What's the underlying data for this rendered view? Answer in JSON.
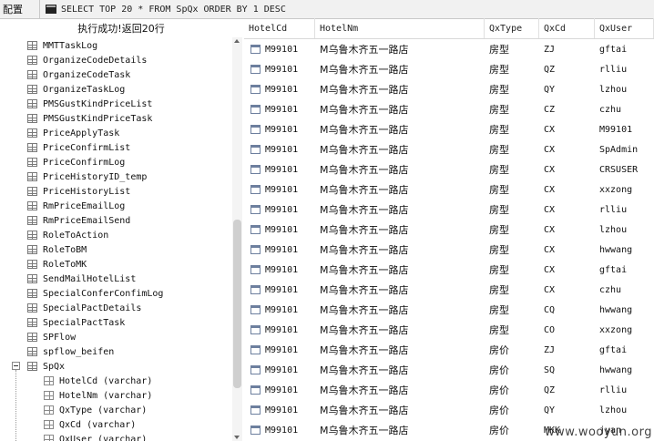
{
  "topbar": {
    "config_label": "配置",
    "query": "SELECT TOP 20 * FROM SpQx ORDER BY 1 DESC"
  },
  "status": "执行成功!返回20行",
  "tree": {
    "tables": [
      "MMTTaskLog",
      "OrganizeCodeDetails",
      "OrganizeCodeTask",
      "OrganizeTaskLog",
      "PMSGustKindPriceList",
      "PMSGustKindPriceTask",
      "PriceApplyTask",
      "PriceConfirmList",
      "PriceConfirmLog",
      "PriceHistoryID_temp",
      "PriceHistoryList",
      "RmPriceEmailLog",
      "RmPriceEmailSend",
      "RoleToAction",
      "RoleToBM",
      "RoleToMK",
      "SendMailHotelList",
      "SpecialConferConfimLog",
      "SpecialPactDetails",
      "SpecialPactTask",
      "SPFlow",
      "spflow_beifen"
    ],
    "expanded": "SpQx",
    "columns": [
      "HotelCd (varchar)",
      "HotelNm (varchar)",
      "QxType (varchar)",
      "QxCd (varchar)",
      "QxUser (varchar)"
    ]
  },
  "grid": {
    "headers": [
      "HotelCd",
      "HotelNm",
      "QxType",
      "QxCd",
      "QxUser"
    ],
    "rows": [
      [
        "M99101",
        "M乌鲁木齐五一路店",
        "房型",
        "ZJ",
        "gftai"
      ],
      [
        "M99101",
        "M乌鲁木齐五一路店",
        "房型",
        "QZ",
        "rlliu"
      ],
      [
        "M99101",
        "M乌鲁木齐五一路店",
        "房型",
        "QY",
        "lzhou"
      ],
      [
        "M99101",
        "M乌鲁木齐五一路店",
        "房型",
        "CZ",
        "czhu"
      ],
      [
        "M99101",
        "M乌鲁木齐五一路店",
        "房型",
        "CX",
        "M99101"
      ],
      [
        "M99101",
        "M乌鲁木齐五一路店",
        "房型",
        "CX",
        "SpAdmin"
      ],
      [
        "M99101",
        "M乌鲁木齐五一路店",
        "房型",
        "CX",
        "CRSUSER"
      ],
      [
        "M99101",
        "M乌鲁木齐五一路店",
        "房型",
        "CX",
        "xxzong"
      ],
      [
        "M99101",
        "M乌鲁木齐五一路店",
        "房型",
        "CX",
        "rlliu"
      ],
      [
        "M99101",
        "M乌鲁木齐五一路店",
        "房型",
        "CX",
        "lzhou"
      ],
      [
        "M99101",
        "M乌鲁木齐五一路店",
        "房型",
        "CX",
        "hwwang"
      ],
      [
        "M99101",
        "M乌鲁木齐五一路店",
        "房型",
        "CX",
        "gftai"
      ],
      [
        "M99101",
        "M乌鲁木齐五一路店",
        "房型",
        "CX",
        "czhu"
      ],
      [
        "M99101",
        "M乌鲁木齐五一路店",
        "房型",
        "CQ",
        "hwwang"
      ],
      [
        "M99101",
        "M乌鲁木齐五一路店",
        "房型",
        "CO",
        "xxzong"
      ],
      [
        "M99101",
        "M乌鲁木齐五一路店",
        "房价",
        "ZJ",
        "gftai"
      ],
      [
        "M99101",
        "M乌鲁木齐五一路店",
        "房价",
        "SQ",
        "hwwang"
      ],
      [
        "M99101",
        "M乌鲁木齐五一路店",
        "房价",
        "QZ",
        "rlliu"
      ],
      [
        "M99101",
        "M乌鲁木齐五一路店",
        "房价",
        "QY",
        "lzhou"
      ],
      [
        "M99101",
        "M乌鲁木齐五一路店",
        "房价",
        "MKK",
        "jyan"
      ]
    ]
  },
  "watermark": "www.wooyun.org"
}
